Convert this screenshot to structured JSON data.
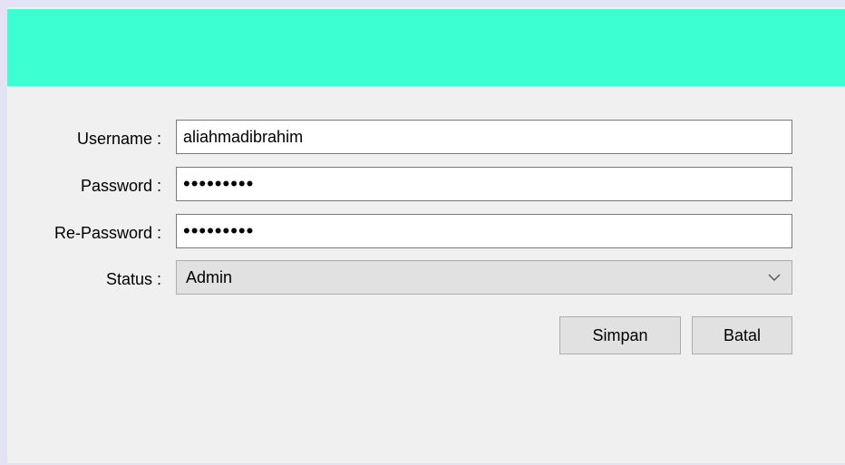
{
  "form": {
    "username": {
      "label": "Username :",
      "value": "aliahmadibrahim"
    },
    "password": {
      "label": "Password :",
      "value": "secretpwd"
    },
    "repassword": {
      "label": "Re-Password :",
      "value": "secretpwd"
    },
    "status": {
      "label": "Status :",
      "selected": "Admin",
      "icon": "chevron-down-icon"
    }
  },
  "buttons": {
    "save_label": "Simpan",
    "cancel_label": "Batal"
  },
  "colors": {
    "header": "#3cffd2",
    "window": "#f0f0f0",
    "frame": "#e3e3f5"
  }
}
